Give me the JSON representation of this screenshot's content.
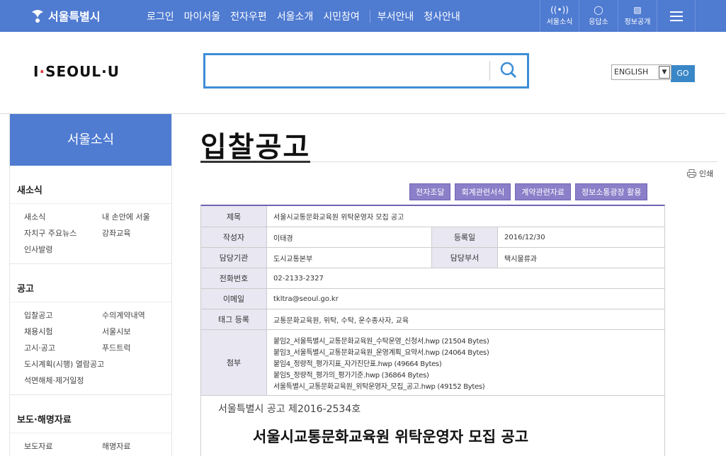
{
  "topbar": {
    "logo": "서울특별시",
    "nav": [
      "로그인",
      "마이서울",
      "전자우편",
      "서울소개",
      "시민참여",
      "부서안내",
      "청사안내"
    ],
    "icons": [
      {
        "label": "서울소식",
        "icon": "broadcast-icon"
      },
      {
        "label": "응답소",
        "icon": "chat-icon"
      },
      {
        "label": "정보공개",
        "icon": "document-icon"
      }
    ]
  },
  "header": {
    "brand_prefix": "I",
    "brand_dot": "·",
    "brand_main": "SEOUL",
    "brand_u": "·U",
    "search_value": "",
    "lang_value": "ENGLISH",
    "lang_go": "GO"
  },
  "sidebar": {
    "title": "서울소식",
    "sections": [
      {
        "title": "새소식",
        "items": [
          "새소식",
          "내 손안에 서울",
          "자치구 주요뉴스",
          "강좌교육",
          "인사발령"
        ]
      },
      {
        "title": "공고",
        "items": [
          "입찰공고",
          "수의계약내역",
          "채용시험",
          "서울시보",
          "고시·공고",
          "푸드트럭",
          "도시계획(시행) 열람공고",
          "",
          "석면해체·제거일정"
        ]
      },
      {
        "title": "보도·해명자료",
        "items": [
          "보도자료",
          "해명자료"
        ]
      }
    ]
  },
  "main": {
    "title": "입찰공고",
    "print_label": "인쇄",
    "tags": [
      "전자조달",
      "회계관련서식",
      "계약관련자료",
      "정보소통광장 활용"
    ],
    "fields": {
      "subject_label": "제목",
      "subject": "서울시교통문화교육원 위탁운영자 모집 공고",
      "author_label": "작성자",
      "author": "이태경",
      "date_label": "등록일",
      "date": "2016/12/30",
      "org_label": "담당기관",
      "org": "도시교통본부",
      "dept_label": "담당부서",
      "dept": "택시물류과",
      "phone_label": "전화번호",
      "phone": "02-2133-2327",
      "email_label": "이메일",
      "email": "tkltra@seoul.go.kr",
      "tag_label": "태그 등록",
      "tag_values": "교통문화교육원, 위탁, 수탁, 운수종사자, 교육",
      "attach_label": "첨부",
      "attachments": [
        "붙임2_서울특별시_교통문화교육원_수탁운영_신청서.hwp (21504 Bytes)",
        "붙임3_서울특별시_교통문화교육원_운영계획_요약서.hwp (24064 Bytes)",
        "붙임4_정량적_평가지표_자가진단표.hwp (49664 Bytes)",
        "붙임5_정량적_평가의_평가기준.hwp (36864 Bytes)",
        "서울특별시_교통문화교육원_위탁운영자_모집_공고.hwp (49152 Bytes)"
      ]
    },
    "notice_no": "서울특별시 공고 제2016-2534호",
    "notice_title": "서울시교통문화교육원 위탁운영자 모집 공고"
  },
  "colors": {
    "brand_blue": "#4f7bd1",
    "tag_purple": "#8a7fc8",
    "search_border": "#3d8dd6"
  }
}
